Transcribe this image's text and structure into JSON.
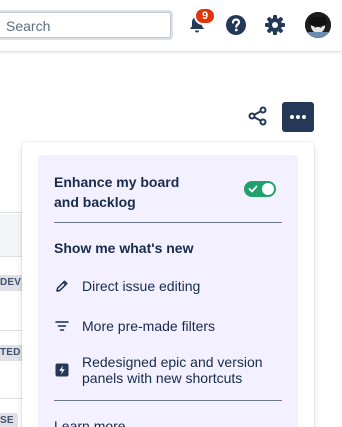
{
  "topbar": {
    "search_placeholder": "Search",
    "notification_count": "9",
    "icons": {
      "notifications": "bell-icon",
      "help": "help-icon",
      "settings": "gear-icon",
      "profile": "avatar"
    }
  },
  "board": {
    "lozenges": [
      "DEV",
      "TED",
      "SE"
    ],
    "actions": {
      "share": "share-icon",
      "more": "more-icon"
    }
  },
  "popup": {
    "enhance_title": "Enhance my board and backlog",
    "toggle_on": true,
    "section_title": "Show me what's new",
    "features": [
      {
        "icon": "pencil-icon",
        "label": "Direct issue editing"
      },
      {
        "icon": "filter-icon",
        "label": "More pre-made filters"
      },
      {
        "icon": "lightning-icon",
        "label": "Redesigned epic and version panels with new shortcuts"
      }
    ],
    "learn_more": "Learn more"
  },
  "colors": {
    "popup_bg": "#f3f0ff",
    "toggle_on": "#22a06b",
    "more_button": "#253858",
    "badge": "#de350b",
    "text": "#172b4d"
  }
}
